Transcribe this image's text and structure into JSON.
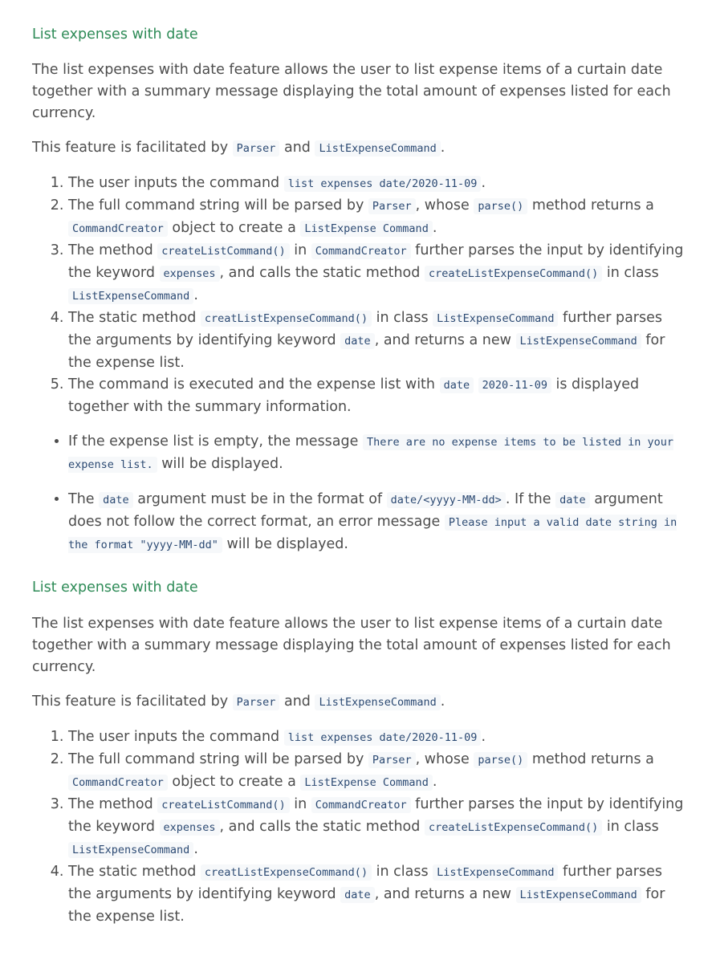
{
  "sections": [
    {
      "heading": "List expenses with date",
      "intro": "The list expenses with date feature allows the user to list expense items of a curtain date together with a summary message displaying the total amount of expenses listed for each currency.",
      "facilitated": {
        "pre": "This feature is facilitated by ",
        "c1": "Parser",
        "mid": " and ",
        "c2": "ListExpenseCommand",
        "post": "."
      },
      "steps": [
        {
          "t1": "The user inputs the command ",
          "c1": "list expenses date/2020-11-09",
          "t2": "."
        },
        {
          "t1": "The full command string will be parsed by ",
          "c1": "Parser",
          "t2": ", whose ",
          "c2": "parse()",
          "t3": " method returns a ",
          "c3": "CommandCreator",
          "t4": " object to create a ",
          "c4": "ListExpense Command",
          "t5": "."
        },
        {
          "t1": "The method ",
          "c1": "createListCommand()",
          "t2": " in ",
          "c2": "CommandCreator",
          "t3": " further parses the input by identifying the keyword ",
          "c3": "expenses",
          "t4": ", and calls the static method ",
          "c4": "createListExpenseCommand()",
          "t5": " in class ",
          "c5": "ListExpenseCommand",
          "t6": "."
        },
        {
          "t1": "The static method ",
          "c1": "creatListExpenseCommand()",
          "t2": " in class ",
          "c2": "ListExpenseCommand",
          "t3": " further parses the arguments by identifying keyword ",
          "c3": "date",
          "t4": ", and returns a new ",
          "c4": "ListExpenseCommand",
          "t5": " for the expense list."
        },
        {
          "t1": "The command is executed and the expense list with ",
          "c1": "date",
          "t2": " ",
          "c2": "2020-11-09",
          "t3": " is displayed together with the summary information."
        }
      ],
      "notes": [
        {
          "t1": "If the expense list is empty, the message ",
          "c1": "There are no expense items to be listed in your expense list.",
          "t2": " will be displayed."
        },
        {
          "t1": "The ",
          "c1": "date",
          "t2": " argument must be in the format of ",
          "c2": "date/<yyyy-MM-dd>",
          "t3": ". If the ",
          "c3": "date",
          "t4": " argument does not follow the correct format, an error message ",
          "c4": "Please input a valid date string in the format \"yyyy-MM-dd\"",
          "t5": " will be displayed."
        }
      ]
    },
    {
      "heading": "List expenses with date",
      "intro": "The list expenses with date feature allows the user to list expense items of a curtain date together with a summary message displaying the total amount of expenses listed for each currency.",
      "facilitated": {
        "pre": "This feature is facilitated by ",
        "c1": "Parser",
        "mid": " and ",
        "c2": "ListExpenseCommand",
        "post": "."
      },
      "steps": [
        {
          "t1": "The user inputs the command ",
          "c1": "list expenses date/2020-11-09",
          "t2": "."
        },
        {
          "t1": "The full command string will be parsed by ",
          "c1": "Parser",
          "t2": ", whose ",
          "c2": "parse()",
          "t3": " method returns a ",
          "c3": "CommandCreator",
          "t4": " object to create a ",
          "c4": "ListExpense Command",
          "t5": "."
        },
        {
          "t1": "The method ",
          "c1": "createListCommand()",
          "t2": " in ",
          "c2": "CommandCreator",
          "t3": " further parses the input by identifying the keyword ",
          "c3": "expenses",
          "t4": ", and calls the static method ",
          "c4": "createListExpenseCommand()",
          "t5": " in class ",
          "c5": "ListExpenseCommand",
          "t6": "."
        },
        {
          "t1": "The static method ",
          "c1": "creatListExpenseCommand()",
          "t2": " in class ",
          "c2": "ListExpenseCommand",
          "t3": " further parses the arguments by identifying keyword ",
          "c3": "date",
          "t4": ", and returns a new ",
          "c4": "ListExpenseCommand",
          "t5": " for the expense list."
        }
      ]
    }
  ]
}
